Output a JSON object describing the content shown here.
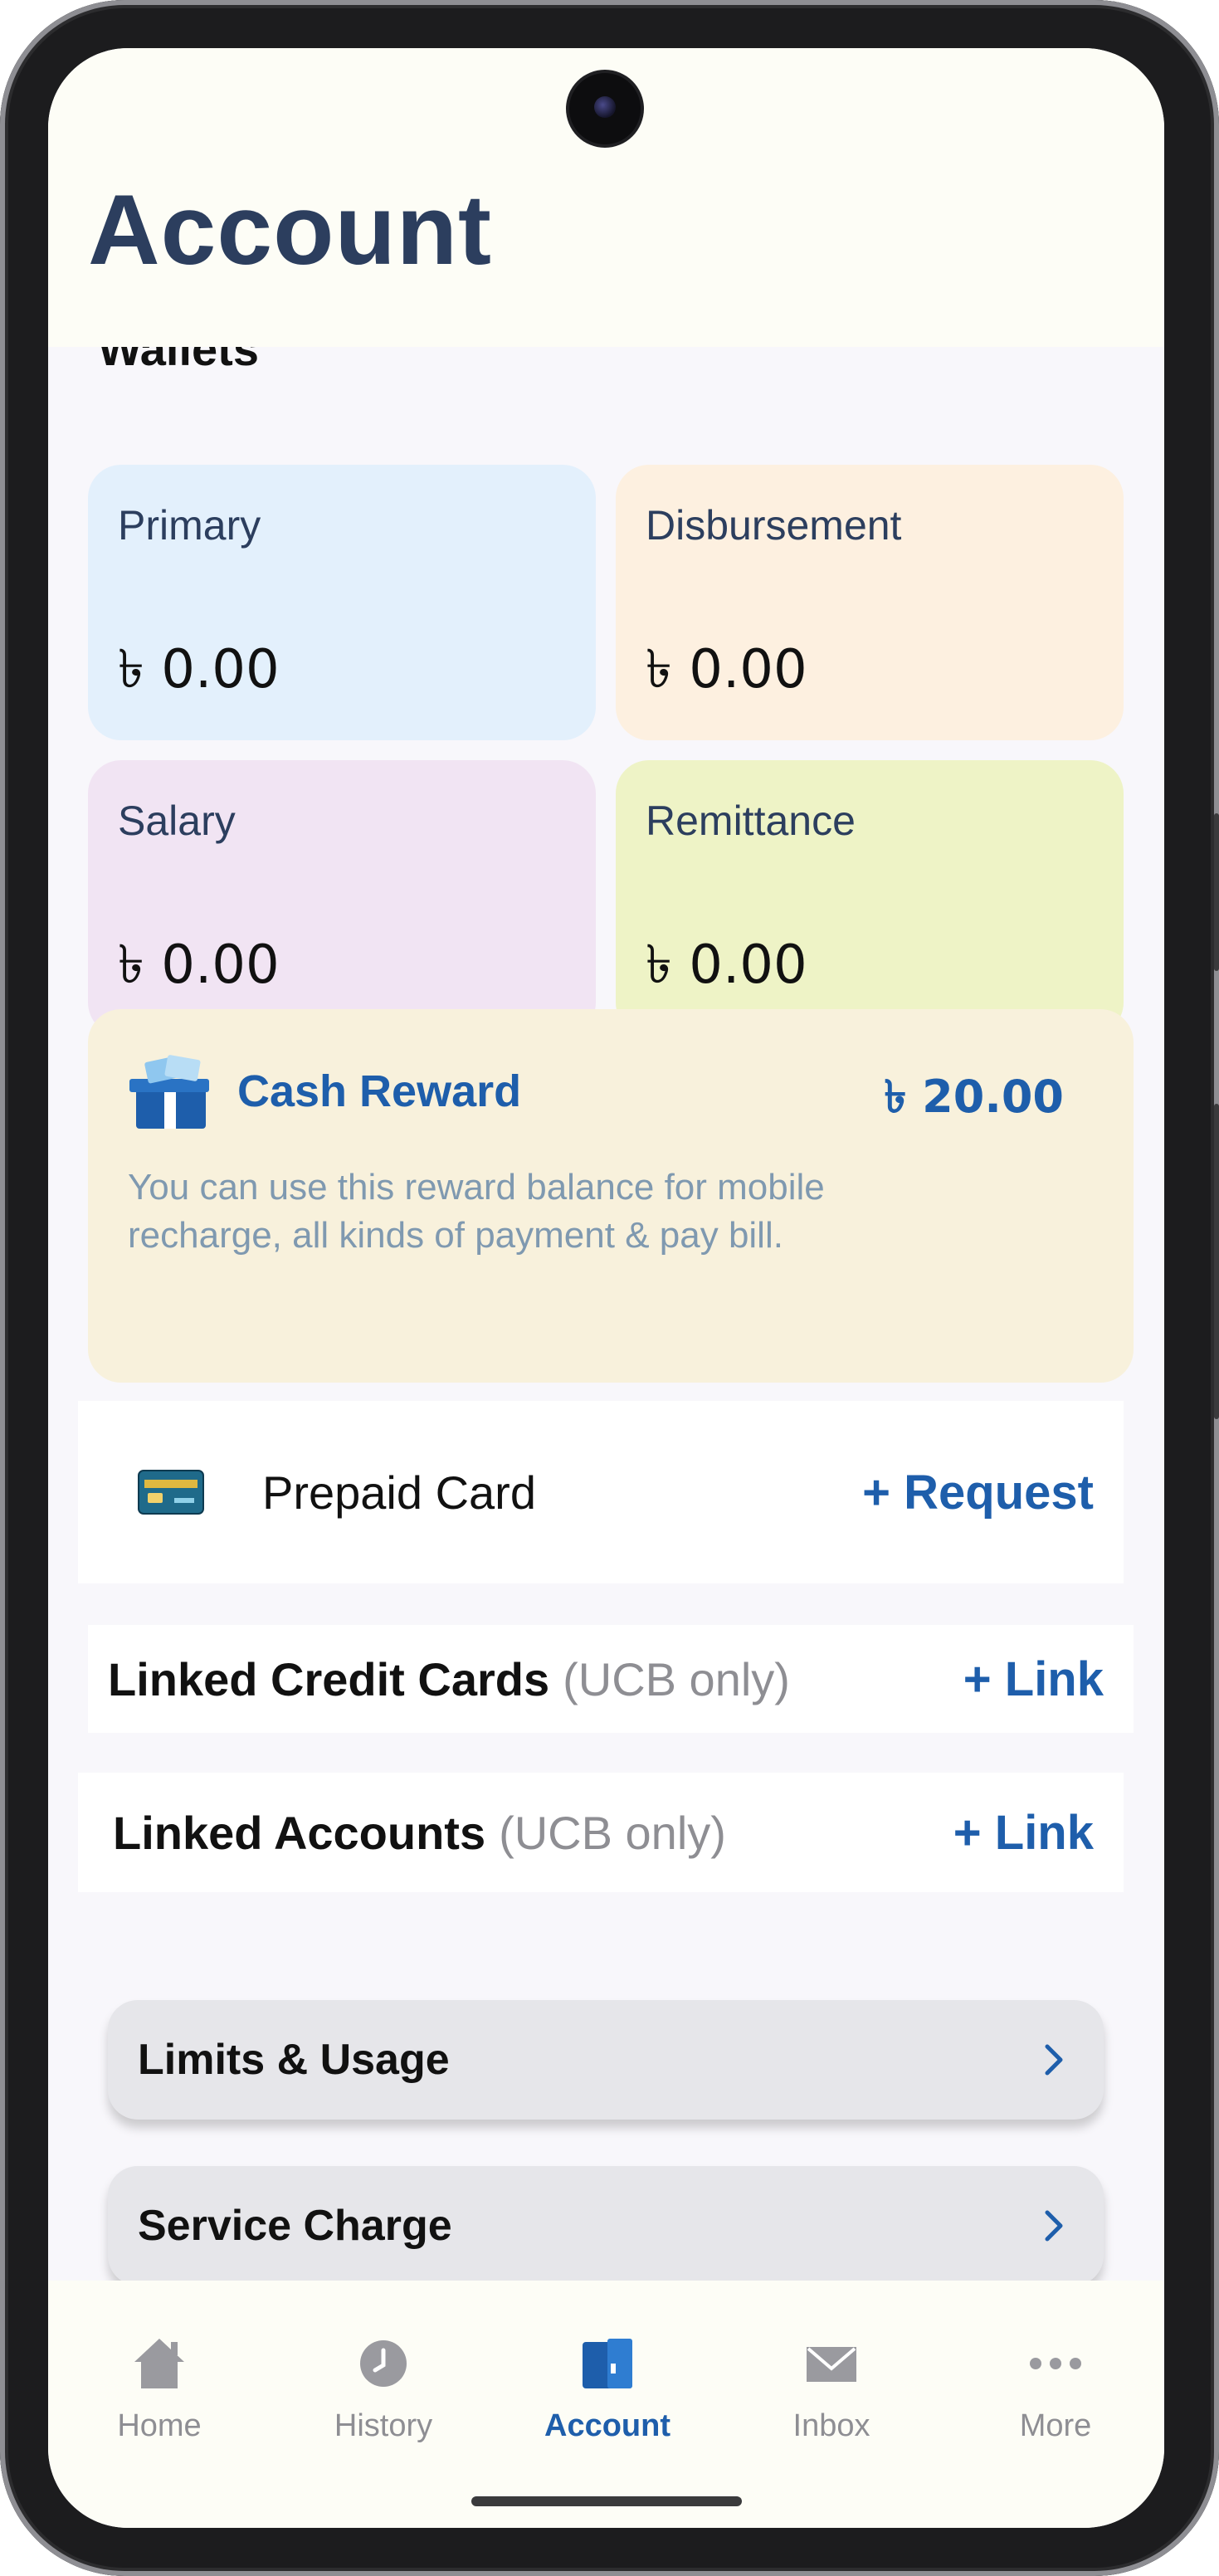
{
  "header": {
    "title": "Account"
  },
  "wallets": {
    "heading": "Wallets",
    "items": [
      {
        "name": "Primary",
        "amount": "৳ 0.00",
        "color": "#e3f0fc"
      },
      {
        "name": "Disbursement",
        "amount": "৳ 0.00",
        "color": "#fdf0e0"
      },
      {
        "name": "Salary",
        "amount": "৳ 0.00",
        "color": "#f1e4f3"
      },
      {
        "name": "Remittance",
        "amount": "৳ 0.00",
        "color": "#eef3c6"
      }
    ]
  },
  "cash_reward": {
    "title": "Cash Reward",
    "amount": "৳ 20.00",
    "description": "You can use this reward balance for mobile recharge, all kinds of payment & pay bill."
  },
  "prepaid_card": {
    "label": "Prepaid Card",
    "action": "+ Request"
  },
  "linked_credit_cards": {
    "label": "Linked Credit Cards",
    "note": "(UCB only)",
    "action": "+ Link"
  },
  "linked_accounts": {
    "label": "Linked Accounts",
    "note": "(UCB only)",
    "action": "+ Link"
  },
  "menu": {
    "limits": "Limits & Usage",
    "service_charge": "Service Charge"
  },
  "bottom_nav": {
    "items": [
      {
        "label": "Home",
        "icon": "home-icon"
      },
      {
        "label": "History",
        "icon": "clock-icon"
      },
      {
        "label": "Account",
        "icon": "account-book-icon",
        "active": true
      },
      {
        "label": "Inbox",
        "icon": "envelope-icon"
      },
      {
        "label": "More",
        "icon": "more-dots-icon"
      }
    ]
  },
  "colors": {
    "accent": "#1e5eab",
    "title": "#2c3e5e",
    "inactive": "#8e8e93"
  }
}
